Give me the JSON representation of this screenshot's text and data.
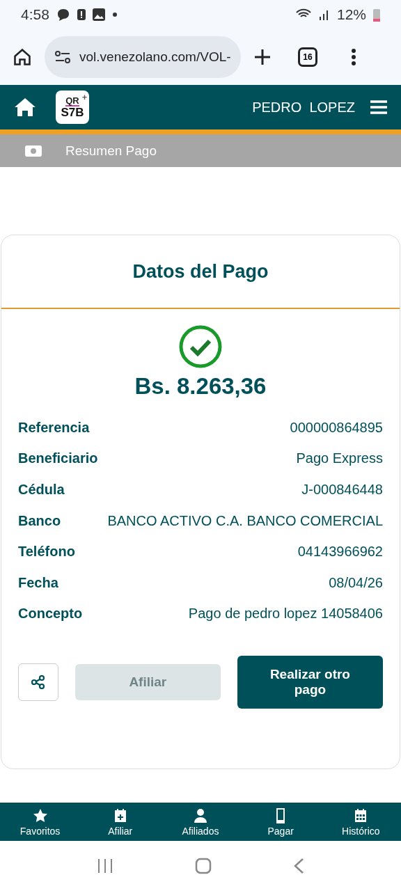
{
  "status_bar": {
    "time": "4:58",
    "battery": "12%"
  },
  "browser": {
    "url": "vol.venezolano.com/VOL-",
    "tab_count": "16"
  },
  "header": {
    "logo": {
      "top": "QR",
      "bottom": "S7B",
      "plus": "+"
    },
    "user": "PEDRO  LOPEZ"
  },
  "breadcrumb": {
    "title": "Resumen Pago"
  },
  "card": {
    "title": "Datos del Pago",
    "amount": "Bs. 8.263,36",
    "details": [
      {
        "label": "Referencia",
        "value": "000000864895"
      },
      {
        "label": "Beneficiario",
        "value": "Pago Express"
      },
      {
        "label": "Cédula",
        "value": "J-000846448"
      },
      {
        "label": "Banco",
        "value": "BANCO ACTIVO C.A. BANCO COMERCIAL"
      },
      {
        "label": "Teléfono",
        "value": "04143966962"
      },
      {
        "label": "Fecha",
        "value": "08/04/26"
      },
      {
        "label": "Concepto",
        "value": "Pago de pedro lopez 14058406"
      }
    ],
    "buttons": [
      {
        "label": "Afiliar",
        "disabled": true
      },
      {
        "label": "Realizar otro pago",
        "disabled": false
      }
    ]
  },
  "bottom_nav": [
    {
      "kind": "star",
      "label": "Favoritos"
    },
    {
      "kind": "calendar-plus",
      "label": "Afiliar"
    },
    {
      "kind": "person",
      "label": "Afiliados"
    },
    {
      "kind": "phone",
      "label": "Pagar"
    },
    {
      "kind": "calendar",
      "label": "Histórico"
    }
  ]
}
